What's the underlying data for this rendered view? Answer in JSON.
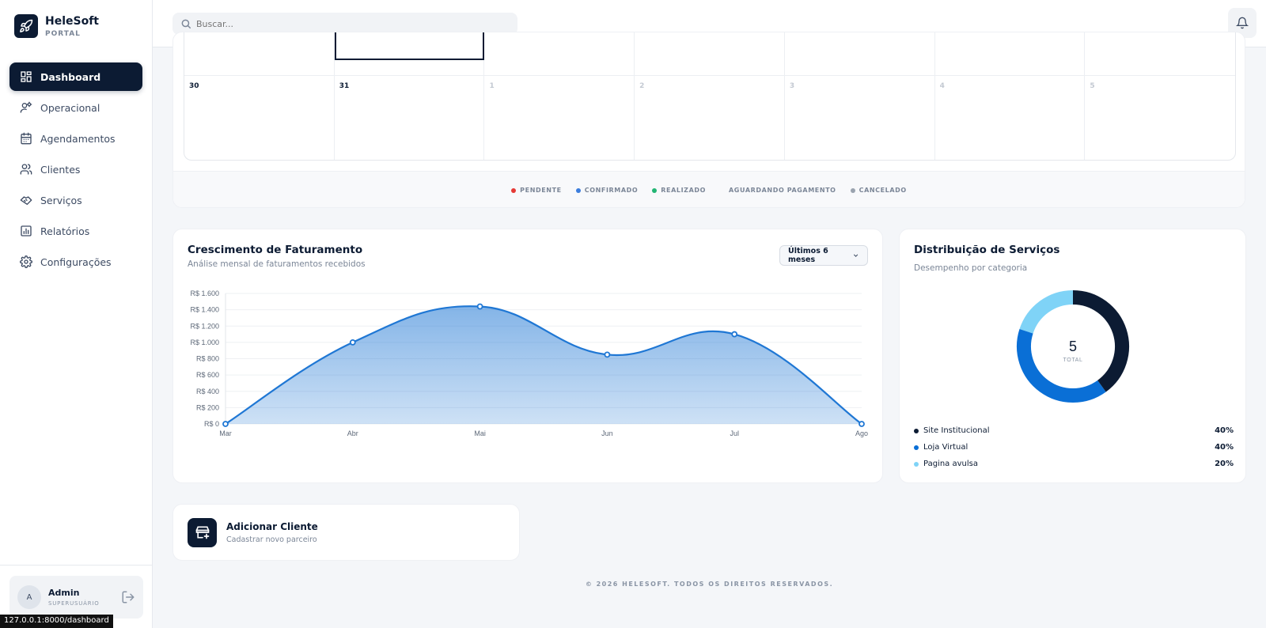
{
  "brand": {
    "name": "HeleSoft",
    "subtitle": "PORTAL"
  },
  "nav": [
    {
      "label": "Dashboard",
      "icon": "dashboard-icon",
      "active": true
    },
    {
      "label": "Operacional",
      "icon": "user-gear-icon"
    },
    {
      "label": "Agendamentos",
      "icon": "calendar-icon"
    },
    {
      "label": "Clientes",
      "icon": "users-icon"
    },
    {
      "label": "Serviços",
      "icon": "handshake-icon"
    },
    {
      "label": "Relatórios",
      "icon": "bar-chart-icon"
    },
    {
      "label": "Configurações",
      "icon": "gear-icon"
    }
  ],
  "user": {
    "initial": "A",
    "name": "Admin",
    "role": "SUPERUSUÁRIO"
  },
  "search": {
    "placeholder": "Buscar..."
  },
  "status_url": "127.0.0.1:8000/dashboard",
  "calendar": {
    "days": [
      {
        "label": "30",
        "muted": false
      },
      {
        "label": "31",
        "muted": false
      },
      {
        "label": "1",
        "muted": true
      },
      {
        "label": "2",
        "muted": true
      },
      {
        "label": "3",
        "muted": true
      },
      {
        "label": "4",
        "muted": true
      },
      {
        "label": "5",
        "muted": true
      }
    ],
    "legend": [
      {
        "label": "PENDENTE",
        "color": "#e53935"
      },
      {
        "label": "CONFIRMADO",
        "color": "#3b7ddd"
      },
      {
        "label": "REALIZADO",
        "color": "#22b573"
      },
      {
        "label": "AGUARDANDO PAGAMENTO",
        "color": ""
      },
      {
        "label": "CANCELADO",
        "color": "#9aa3af"
      }
    ]
  },
  "revenue": {
    "title": "Crescimento de Faturamento",
    "subtitle": "Análise mensal de faturamentos recebidos",
    "range_label": "Últimos 6 meses"
  },
  "chart_data": {
    "type": "area",
    "categories": [
      "Mar",
      "Abr",
      "Mai",
      "Jun",
      "Jul",
      "Ago"
    ],
    "series": [
      {
        "values": [
          0,
          1000,
          1440,
          850,
          1100,
          0
        ]
      }
    ],
    "y_ticks": [
      "R$ 0",
      "R$ 200",
      "R$ 400",
      "R$ 600",
      "R$ 800",
      "R$ 1.000",
      "R$ 1.200",
      "R$ 1.400",
      "R$ 1.600"
    ],
    "ylim": [
      0,
      1600
    ],
    "color": "#1f77d4",
    "grid": true
  },
  "distribution": {
    "title": "Distribuição de Serviços",
    "subtitle": "Desempenho por categoria",
    "total_value": "5",
    "total_label": "TOTAL",
    "items": [
      {
        "label": "Site Institucional",
        "value": "40%",
        "pct": 40,
        "color": "#0c1b33"
      },
      {
        "label": "Loja Virtual",
        "value": "40%",
        "pct": 40,
        "color": "#0a6fd6"
      },
      {
        "label": "Pagina avulsa",
        "value": "20%",
        "pct": 20,
        "color": "#7fd3f7"
      }
    ]
  },
  "add_client": {
    "title": "Adicionar Cliente",
    "subtitle": "Cadastrar novo parceiro"
  },
  "footer": "© 2026 HELESOFT. TODOS OS DIREITOS RESERVADOS."
}
